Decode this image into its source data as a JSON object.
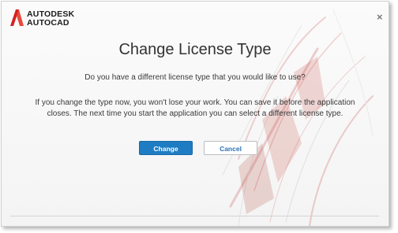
{
  "app": {
    "brand": "AUTODESK",
    "product": "AUTOCAD",
    "logo_icon": "autodesk-a-logo-icon",
    "close_icon": "close-icon",
    "close_glyph": "×"
  },
  "dialog": {
    "title": "Change License Type",
    "question": "Do you have a different license type that you would like to use?",
    "body_lines": [
      "If you change the type now, you won't lose your work. You can save it before the application",
      "closes. The next time you start the application you can select a different license type."
    ]
  },
  "buttons": {
    "change_label": "Change",
    "cancel_label": "Cancel"
  },
  "colors": {
    "accent": "#1e7cc3",
    "logo_red": "#d32222",
    "link_text": "#2b72b8"
  }
}
